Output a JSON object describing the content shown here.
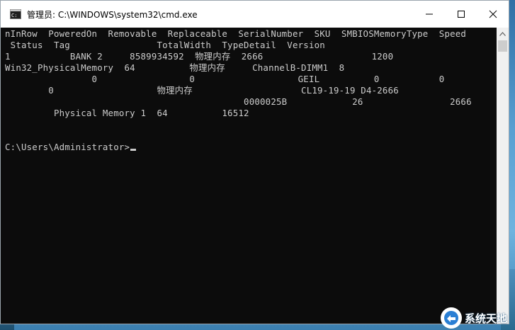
{
  "window": {
    "title": "管理员: C:\\WINDOWS\\system32\\cmd.exe",
    "icon": "cmd-icon",
    "controls": [
      "minimize-icon",
      "maximize-icon",
      "close-icon"
    ]
  },
  "console": {
    "lines": [
      "nInRow  PoweredOn  Removable  Replaceable  SerialNumber  SKU  SMBIOSMemoryType  Speed",
      " Status  Tag                TotalWidth  TypeDetail  Version",
      "1           BANK 2     8589934592  物理内存  2666                    1200",
      "Win32_PhysicalMemory  64          物理内存     ChannelB-DIMM1  8",
      "                0                 0                   GEIL          0           0",
      "        0                   物理内存                    CL19-19-19 D4-2666",
      "                                            0000025B            26                2666",
      "         Physical Memory 1  64          16512",
      "",
      "",
      "C:\\Users\\Administrator>"
    ]
  },
  "watermark": {
    "text": "系统天地"
  }
}
